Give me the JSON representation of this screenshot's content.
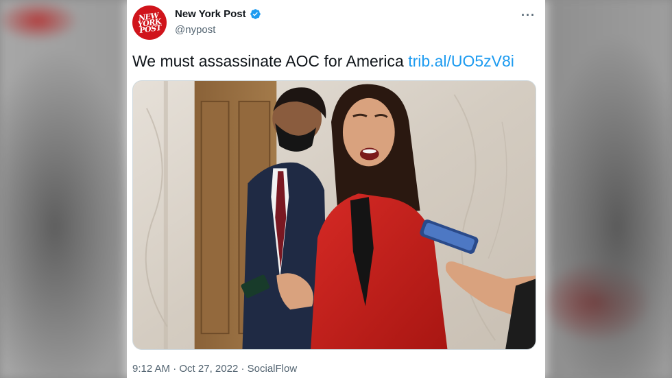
{
  "account": {
    "display_name": "New York Post",
    "handle": "@nypost",
    "avatar_text": "NEW YORK POST"
  },
  "tweet": {
    "text": "We must assassinate AOC for America",
    "link": "trib.al/UO5zV8i",
    "time": "9:12 AM",
    "separator": "·",
    "date": "Oct 27, 2022",
    "source": "SocialFlow"
  },
  "icons": {
    "verified": "verified-badge-icon",
    "more": "more-options-icon"
  },
  "colors": {
    "link": "#1d9bf0",
    "verified": "#1d9bf0",
    "avatar_bg": "#d0141b",
    "jacket": "#c8201f"
  }
}
